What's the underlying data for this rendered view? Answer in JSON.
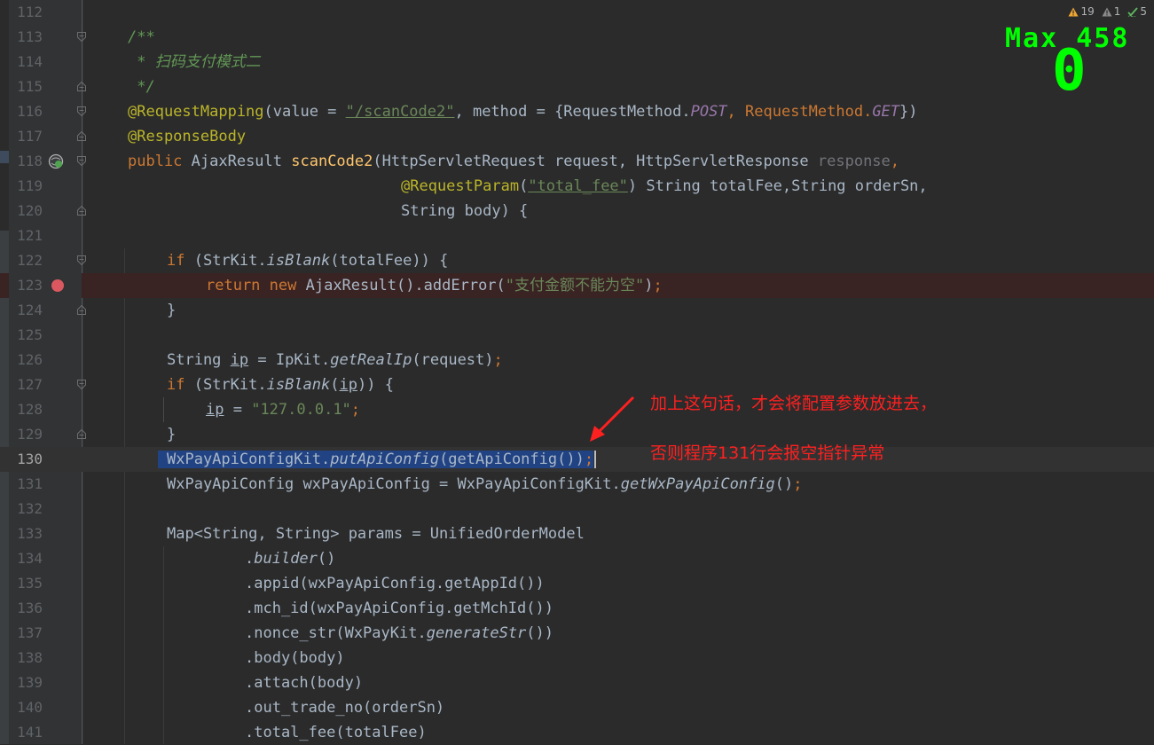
{
  "inspections": {
    "warnings": "19",
    "weak_warnings": "1",
    "typos": "5"
  },
  "overlay": {
    "max_label": "Max 458",
    "counter": "0"
  },
  "annotation": {
    "line1": "加上这句话，才会将配置参数放进去，",
    "line2": "否则程序131行会报空指针异常",
    "arrow_color": "#ff2020"
  },
  "colors": {
    "background": "#2b2b2b",
    "keyword": "#cc7832",
    "annotation": "#bbb529",
    "string": "#6a8759",
    "comment": "#629755",
    "selection": "#214283",
    "breakpoint": "#db5860",
    "overlay": "#00ff00"
  },
  "line_numbers": [
    "112",
    "113",
    "114",
    "115",
    "116",
    "117",
    "118",
    "119",
    "120",
    "121",
    "122",
    "123",
    "124",
    "125",
    "126",
    "127",
    "128",
    "129",
    "130",
    "131",
    "132",
    "133",
    "134",
    "135",
    "136",
    "137",
    "138",
    "139",
    "140",
    "141"
  ],
  "code": {
    "l113": "/**",
    "l114": " * 扫码支付模式二",
    "l115": " */",
    "l116_ann": "@RequestMapping",
    "l116_a": "(value = ",
    "l116_str": "\"/scanCode2\"",
    "l116_b": ", method = {RequestMethod.",
    "l116_post": "POST",
    "l116_c": ", RequestMethod.",
    "l116_get": "GET",
    "l116_d": "})",
    "l117": "@ResponseBody",
    "l118_kw": "public ",
    "l118_a": "AjaxResult ",
    "l118_fn": "scanCode2",
    "l118_b": "(HttpServletRequest request, HttpServletResponse ",
    "l118_resp": "response",
    "l118_c": ",",
    "l119_ann": "@RequestParam",
    "l119_a": "(",
    "l119_str": "\"total_fee\"",
    "l119_b": ") String totalFee,String orderSn,",
    "l120": "String body) {",
    "l122_kw": "if ",
    "l122_a": "(StrKit.",
    "l122_it": "isBlank",
    "l122_b": "(totalFee)) {",
    "l123_kw1": "return ",
    "l123_kw2": "new ",
    "l123_a": "AjaxResult().addError(",
    "l123_str": "\"支付金额不能为空\"",
    "l123_b": ")",
    "l123_semi": ";",
    "l124": "}",
    "l126_a": "String ",
    "l126_ip": "ip",
    "l126_b": " = IpKit.",
    "l126_it": "getRealIp",
    "l126_c": "(request)",
    "l126_semi": ";",
    "l127_kw": "if ",
    "l127_a": "(StrKit.",
    "l127_it": "isBlank",
    "l127_b": "(",
    "l127_ip": "ip",
    "l127_c": ")) {",
    "l128_ip": "ip",
    "l128_a": " = ",
    "l128_str": "\"127.0.0.1\"",
    "l128_semi": ";",
    "l129": "}",
    "l130_a": "WxPayApiConfigKit.",
    "l130_it": "putApiConfig",
    "l130_b": "(getApiConfig())",
    "l130_semi": ";",
    "l131_a": "WxPayApiConfig wxPayApiConfig = WxPayApiConfigKit.",
    "l131_it": "getWxPayApiConfig",
    "l131_b": "()",
    "l131_semi": ";",
    "l133": "Map<String, String> params = UnifiedOrderModel",
    "l134_a": ".",
    "l134_it": "builder",
    "l134_b": "()",
    "l135": ".appid(wxPayApiConfig.getAppId())",
    "l136": ".mch_id(wxPayApiConfig.getMchId())",
    "l137_a": ".nonce_str(WxPayKit.",
    "l137_it": "generateStr",
    "l137_b": "())",
    "l138": ".body(body)",
    "l139": ".attach(body)",
    "l140": ".out_trade_no(orderSn)",
    "l141": ".total_fee(totalFee)"
  }
}
